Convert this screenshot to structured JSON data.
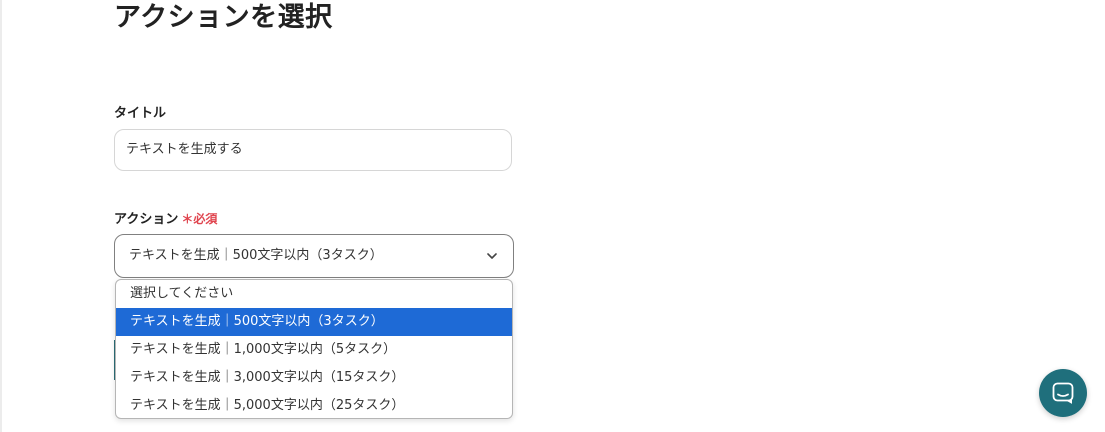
{
  "page": {
    "title": "アクションを選択"
  },
  "form": {
    "title_field": {
      "label": "タイトル",
      "value": "テキストを生成する"
    },
    "action_field": {
      "label": "アクション",
      "required_mark": "＊",
      "required_text": "必須",
      "selected_value": "テキストを生成｜500文字以内（3タスク）",
      "options": [
        "選択してください",
        "テキストを生成｜500文字以内（3タスク）",
        "テキストを生成｜1,000文字以内（5タスク）",
        "テキストを生成｜3,000文字以内（15タスク）",
        "テキストを生成｜5,000文字以内（25タスク）"
      ],
      "highlighted_index": 1
    }
  },
  "colors": {
    "accent_blue": "#1e6ad6",
    "required_red": "#e0454f",
    "chat_teal": "#1f6f7c"
  },
  "icons": {
    "select_chevron": "chevron-down-icon",
    "chat": "chat-bubble-icon"
  }
}
